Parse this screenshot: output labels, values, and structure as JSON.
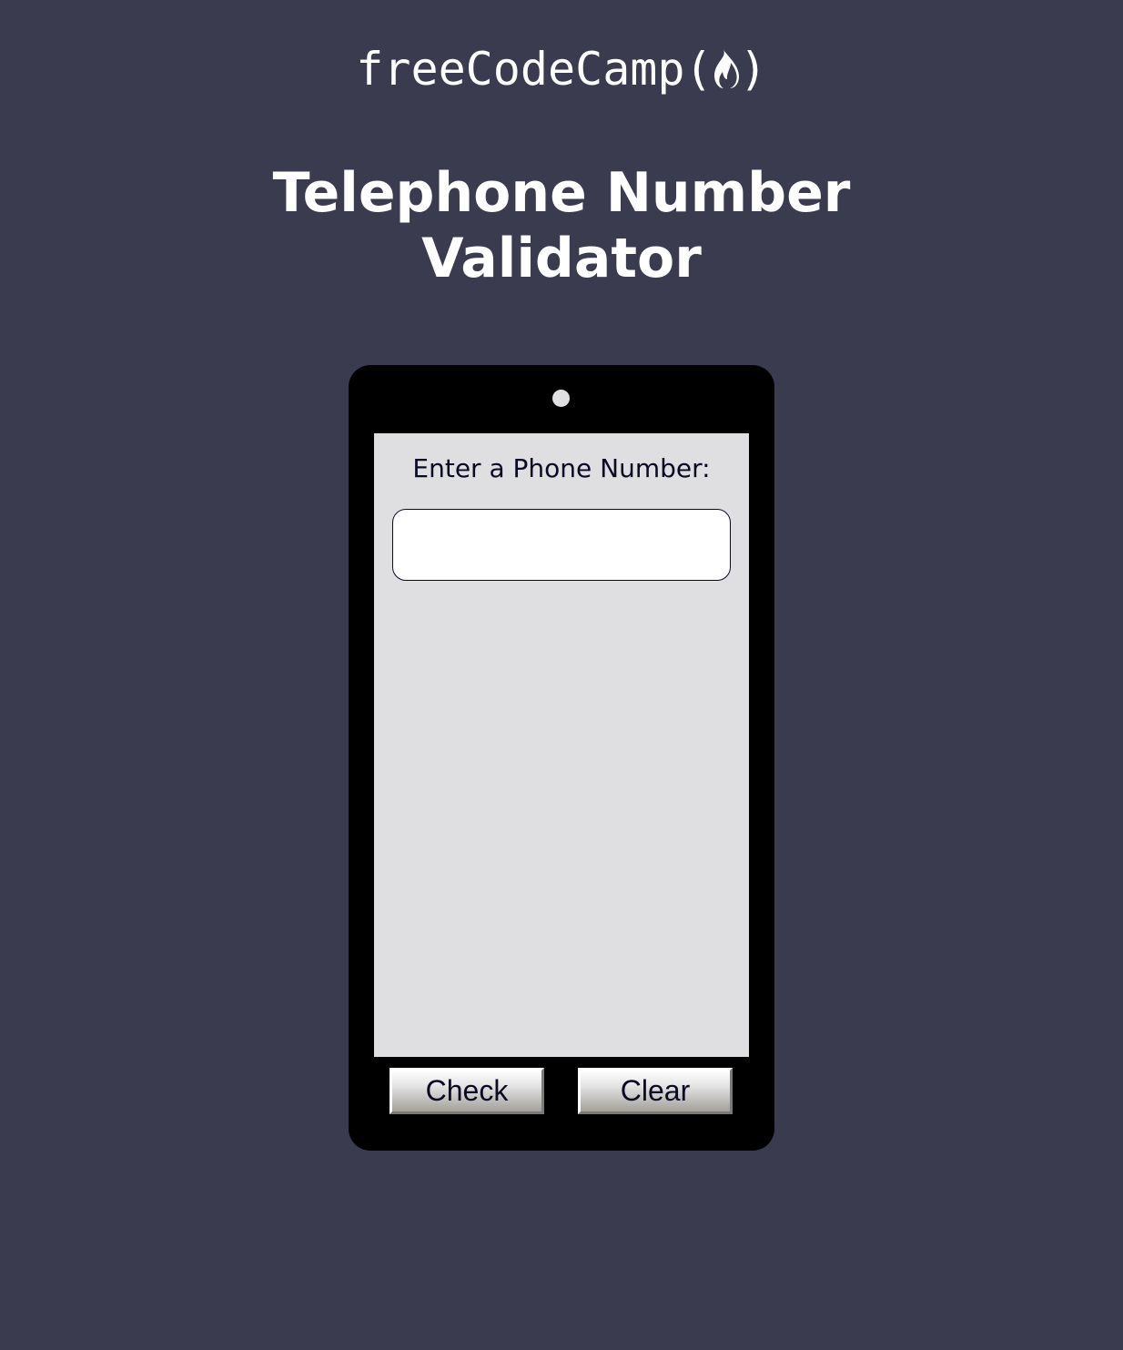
{
  "header": {
    "logo_text": "freeCodeCamp",
    "logo_open_paren": "(",
    "logo_close_paren": ")",
    "logo_icon": "flame-icon"
  },
  "page": {
    "title_line1": "Telephone Number",
    "title_line2": "Validator"
  },
  "phone": {
    "label": "Enter a Phone Number:",
    "input_value": "",
    "input_placeholder": "",
    "check_label": "Check",
    "clear_label": "Clear"
  },
  "colors": {
    "background": "#3b3b4f",
    "phone_body": "#000000",
    "screen": "#dfdfe2",
    "text_dark": "#0a0a23",
    "text_light": "#ffffff"
  }
}
